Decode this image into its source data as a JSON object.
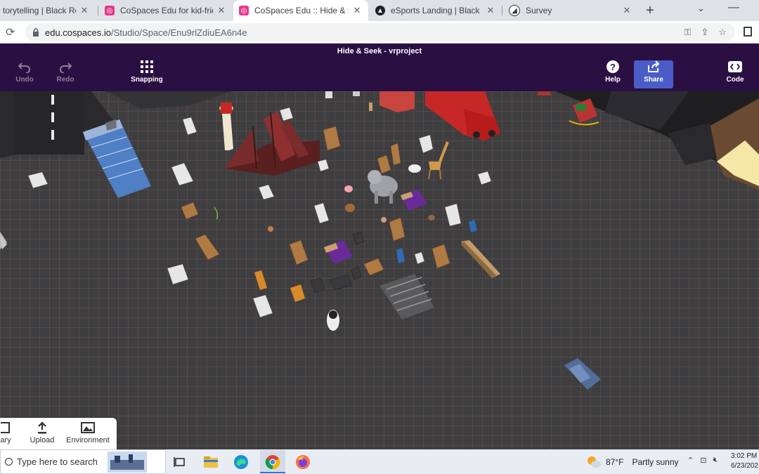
{
  "browser": {
    "tabs": [
      {
        "title": "torytelling | Black Rocket",
        "active": false
      },
      {
        "title": "CoSpaces Edu for kid-friendly",
        "active": false
      },
      {
        "title": "CoSpaces Edu :: Hide & Seek",
        "active": true
      },
      {
        "title": "eSports Landing | Black Rocke",
        "active": false
      },
      {
        "title": "Survey",
        "active": false
      }
    ],
    "new_tab": "+",
    "url_host": "edu.cospaces.io",
    "url_path": "/Studio/Space/Enu9rlZdiuEA6n4e"
  },
  "toolbar": {
    "title": "Hide & Seek - vrproject",
    "undo": "Undo",
    "redo": "Redo",
    "snapping": "Snapping",
    "help": "Help",
    "share": "Share",
    "code": "Code"
  },
  "library_panel": {
    "library": "ary",
    "upload": "Upload",
    "environment": "Environment"
  },
  "taskbar": {
    "search_placeholder": "Type here to search",
    "temperature": "87°F",
    "weather": "Partly sunny",
    "time": "3:02 PM",
    "date": "6/23/202"
  },
  "colors": {
    "toolbar_bg": "#2a0f43",
    "share_bg": "#4a5cc7",
    "active_tab": "#ffffff"
  }
}
